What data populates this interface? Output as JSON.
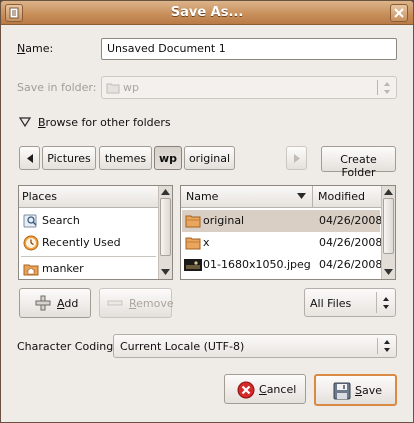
{
  "window": {
    "title": "Save As..."
  },
  "name": {
    "label": "Name:",
    "label_mnemonic": "N",
    "label_rest": "ame:",
    "value": "Unsaved Document 1"
  },
  "save_in": {
    "label": "Save in folder:",
    "value": "wp"
  },
  "browse": {
    "label": "Browse for other folders",
    "mnemonic": "B",
    "rest": "rowse for other folders"
  },
  "path_bar": {
    "crumbs": [
      "Pictures",
      "themes",
      "wp",
      "original"
    ],
    "active": "wp",
    "create_folder": "Create Folder"
  },
  "places": {
    "header": "Places",
    "items": [
      {
        "label": "Search",
        "icon": "search-icon"
      },
      {
        "label": "Recently Used",
        "icon": "recent-icon"
      },
      {
        "label": "manker",
        "icon": "home-folder-icon"
      }
    ]
  },
  "files": {
    "columns": {
      "name": "Name",
      "modified": "Modified"
    },
    "rows": [
      {
        "name": "original",
        "modified": "04/26/2008",
        "icon": "folder-icon",
        "selected": true
      },
      {
        "name": "x",
        "modified": "04/26/2008",
        "icon": "folder-icon",
        "selected": false
      },
      {
        "name": "01-1680x1050.jpeg",
        "modified": "04/26/2008",
        "icon": "image-thumbnail-icon",
        "selected": false
      }
    ]
  },
  "actions": {
    "add": {
      "mnemonic": "A",
      "rest": "dd"
    },
    "remove": {
      "mnemonic": "R",
      "rest": "emove"
    },
    "filter": "All Files"
  },
  "encoding": {
    "label": "Character Coding:",
    "value": "Current Locale (UTF-8)"
  },
  "buttons": {
    "cancel": {
      "mnemonic": "C",
      "rest": "ancel"
    },
    "save": {
      "mnemonic": "S",
      "rest": "ave"
    }
  },
  "colors": {
    "titlebar": "#c9905c",
    "accent_border": "#d98a43",
    "selection": "#d9cfc5",
    "cancel_red": "#cc2020"
  }
}
